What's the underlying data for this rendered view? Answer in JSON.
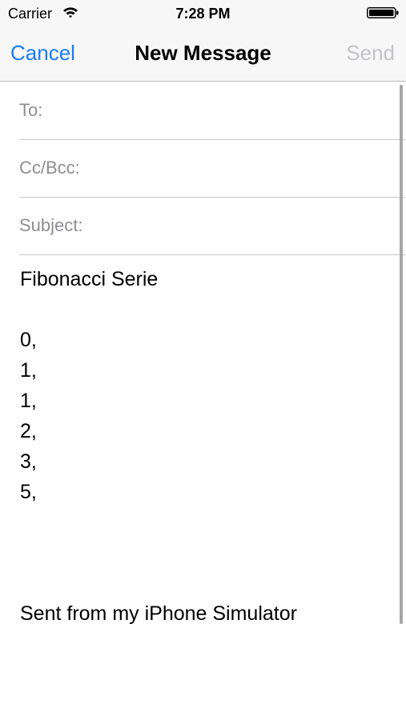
{
  "status_bar": {
    "carrier": "Carrier",
    "time": "7:28 PM",
    "wifi_icon": "wifi-icon",
    "battery_icon": "battery-icon"
  },
  "nav": {
    "cancel_label": "Cancel",
    "title": "New Message",
    "send_label": "Send"
  },
  "fields": {
    "to_label": "To:",
    "to_value": "",
    "cc_bcc_label": "Cc/Bcc:",
    "cc_bcc_value": "",
    "subject_label": "Subject:",
    "subject_value": ""
  },
  "message": {
    "lines": [
      "Fibonacci Serie",
      "",
      "0,",
      "1,",
      "1,",
      "2,",
      "3,",
      "5,"
    ],
    "signature": "Sent from my iPhone Simulator"
  },
  "colors": {
    "accent": "#1a7cf5",
    "disabled": "#c4c4c8",
    "label": "#8e8e93",
    "bar_background": "#f7f7f8"
  }
}
